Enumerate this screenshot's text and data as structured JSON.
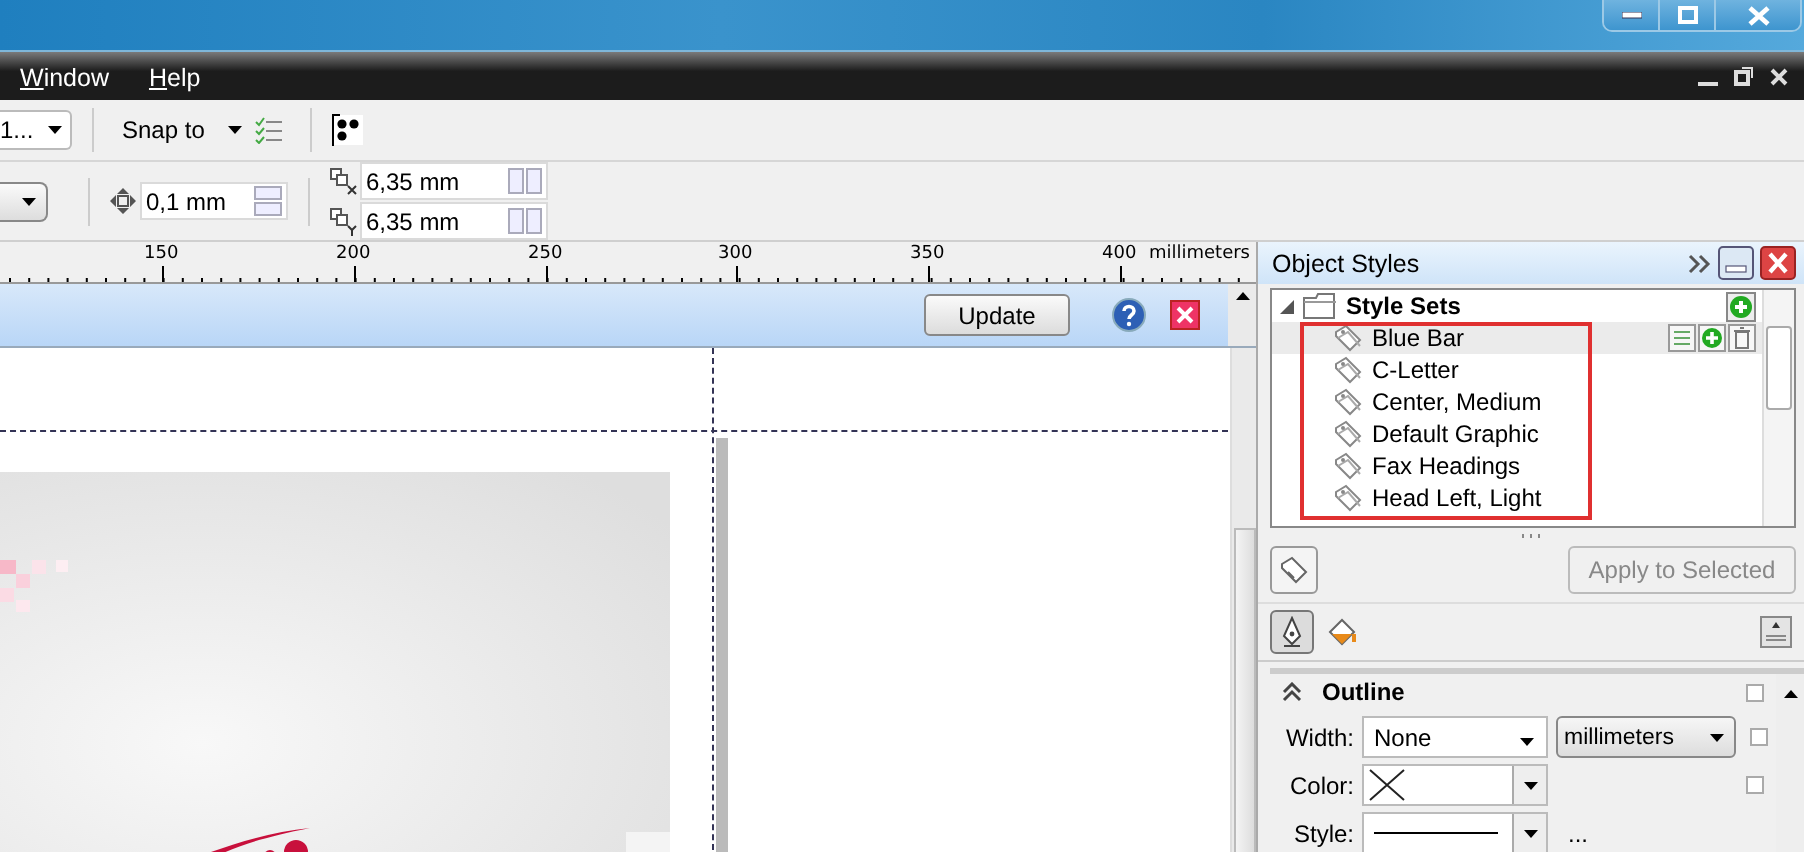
{
  "menu": [
    {
      "label": "Window"
    },
    {
      "label": "Help"
    }
  ],
  "toolbar": {
    "dropdown": "1...",
    "snap": "Snap to",
    "nudge": "0,1 mm",
    "duplicate_x": "6,35 mm",
    "duplicate_y": "6,35 mm"
  },
  "ruler": {
    "labels": [
      "150",
      "200",
      "250",
      "300",
      "350",
      "400"
    ],
    "unit": "millimeters"
  },
  "docker_bar": {
    "button": "Update"
  },
  "panel": {
    "title": "Object Styles",
    "tree": {
      "label": "Style Sets",
      "expanded": true,
      "children": [
        {
          "label": "Blue Bar",
          "selected": true
        },
        {
          "label": "C-Letter",
          "selected": false
        },
        {
          "label": "Center, Medium",
          "selected": false
        },
        {
          "label": "Default Graphic",
          "selected": false
        },
        {
          "label": "Fax Headings",
          "selected": false
        },
        {
          "label": "Head Left, Light",
          "selected": false
        }
      ]
    },
    "apply_button": {
      "label": "Apply to Selected",
      "disabled": true
    },
    "tabs": [
      {
        "kind": "outline",
        "selected": true
      },
      {
        "kind": "fill",
        "selected": false
      }
    ],
    "section": {
      "title": "Outline",
      "expanded": true,
      "checks": [
        {
          "checked": false
        },
        {
          "checked": false
        },
        {
          "checked": false
        }
      ],
      "width_label": "Width:",
      "width": "None",
      "unit": "millimeters",
      "color_label": "Color:",
      "style_label": "Style:",
      "more": "..."
    }
  }
}
